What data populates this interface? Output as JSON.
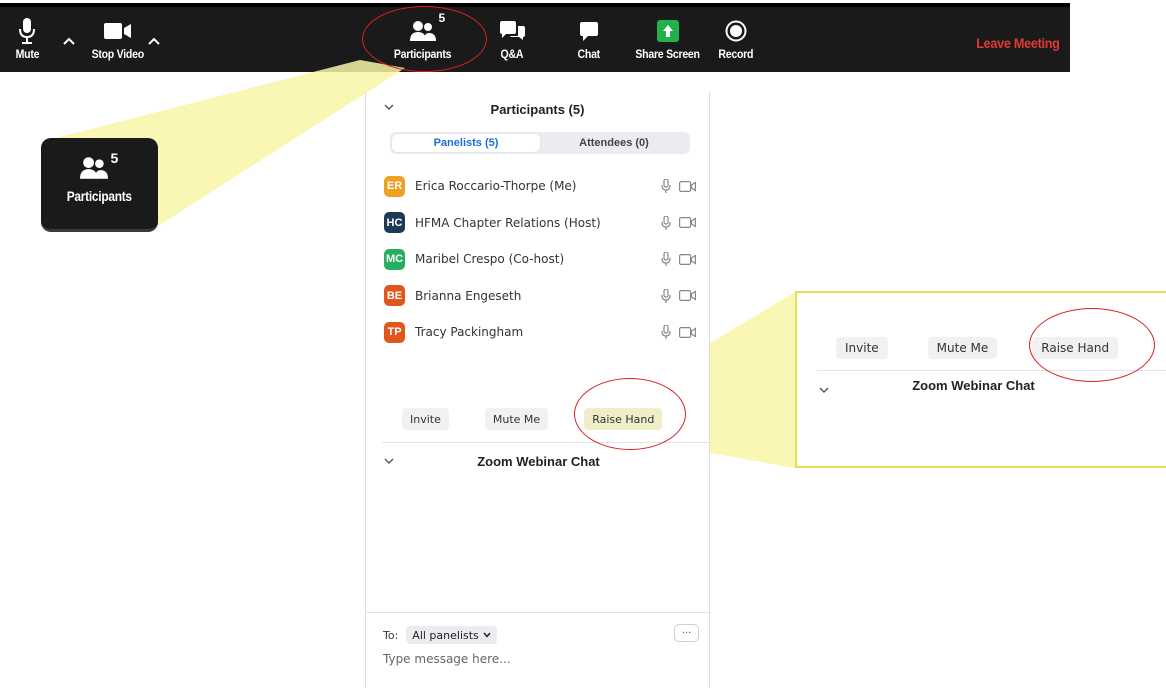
{
  "toolbar": {
    "mute_label": "Mute",
    "stop_video_label": "Stop Video",
    "participants_label": "Participants",
    "participants_count": "5",
    "qa_label": "Q&A",
    "chat_label": "Chat",
    "share_screen_label": "Share Screen",
    "record_label": "Record",
    "leave_label": "Leave Meeting"
  },
  "zoom_left": {
    "count": "5",
    "label": "Participants"
  },
  "panel": {
    "title": "Participants (5)",
    "tabs": [
      {
        "label": "Panelists (5)",
        "active": true
      },
      {
        "label": "Attendees (0)",
        "active": false
      }
    ],
    "participants": [
      {
        "initials": "ER",
        "name": "Erica Roccario-Thorpe (Me)",
        "color": "#f0a020"
      },
      {
        "initials": "HC",
        "name": "HFMA Chapter Relations (Host)",
        "color": "#1f3a57"
      },
      {
        "initials": "MC",
        "name": "Maribel Crespo (Co-host)",
        "color": "#27ae60"
      },
      {
        "initials": "BE",
        "name": "Brianna Engeseth",
        "color": "#e0561b"
      },
      {
        "initials": "TP",
        "name": "Tracy Packingham",
        "color": "#e0561b"
      }
    ],
    "actions": {
      "invite": "Invite",
      "mute_me": "Mute Me",
      "raise_hand": "Raise Hand"
    },
    "chat_title": "Zoom Webinar Chat",
    "to_label": "To:",
    "to_value": "All panelists",
    "more_label": "···",
    "message_placeholder": "Type message here..."
  },
  "zoom_right": {
    "invite": "Invite",
    "mute_me": "Mute Me",
    "raise_hand": "Raise Hand",
    "chat_title": "Zoom Webinar Chat"
  },
  "colors": {
    "toolbar_bg": "#1a1a1a",
    "leave_red": "#e53935",
    "share_green": "#23b14d",
    "active_tab_blue": "#1a6fd6",
    "highlight_yellow": "#f8f6a6",
    "ring_red": "#d62020"
  }
}
